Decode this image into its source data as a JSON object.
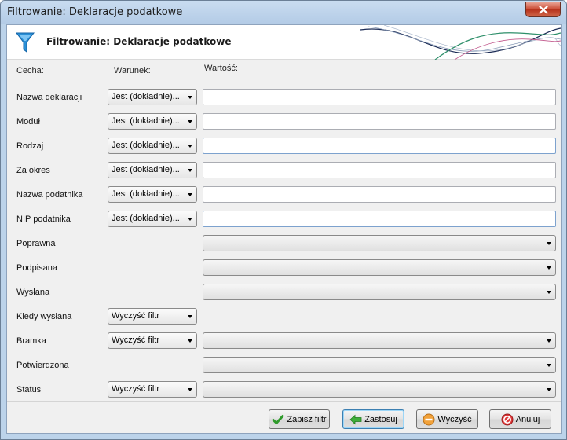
{
  "window": {
    "title": "Filtrowanie: Deklaracje podatkowe"
  },
  "header": {
    "title": "Filtrowanie: Deklaracje podatkowe",
    "icon": "funnel-icon",
    "accent_color": "#2a8fd6"
  },
  "columns": {
    "feature": "Cecha:",
    "condition": "Warunek:",
    "value": "Wartość:"
  },
  "rows": [
    {
      "label": "Nazwa deklaracji",
      "condition": "Jest (dokładnie)...",
      "value": ""
    },
    {
      "label": "Moduł",
      "condition": "Jest (dokładnie)...",
      "value": ""
    },
    {
      "label": "Rodzaj",
      "condition": "Jest (dokładnie)...",
      "value": ""
    },
    {
      "label": "Za okres",
      "condition": "Jest (dokładnie)...",
      "value": ""
    },
    {
      "label": "Nazwa podatnika",
      "condition": "Jest (dokładnie)...",
      "value": ""
    },
    {
      "label": "NIP podatnika",
      "condition": "Jest (dokładnie)...",
      "value": ""
    },
    {
      "label": "Poprawna",
      "value": ""
    },
    {
      "label": "Podpisana",
      "value": ""
    },
    {
      "label": "Wysłana",
      "value": ""
    },
    {
      "label": "Kiedy wysłana",
      "condition": "Wyczyść filtr"
    },
    {
      "label": "Bramka",
      "condition": "Wyczyść filtr",
      "value": ""
    },
    {
      "label": "Potwierdzona",
      "value": ""
    },
    {
      "label": "Status",
      "condition": "Wyczyść filtr",
      "value": ""
    }
  ],
  "buttons": {
    "save_filter": "Zapisz filtr",
    "apply": "Zastosuj",
    "clear": "Wyczyść",
    "cancel": "Anuluj"
  }
}
